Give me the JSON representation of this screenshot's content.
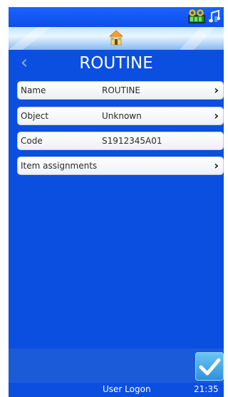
{
  "header": {
    "title": "ROUTINE",
    "home_icon": "home-icon",
    "back_icon": "chevron-left-icon"
  },
  "status": {
    "icons": [
      "device-status-icon",
      "sound-notes-icon"
    ]
  },
  "rows": [
    {
      "label": "Name",
      "value": "ROUTINE",
      "has_chevron": true
    },
    {
      "label": "Object",
      "value": "Unknown",
      "has_chevron": true
    },
    {
      "label": "Code",
      "value": "S1912345A01",
      "has_chevron": false
    },
    {
      "label": "Item assignments",
      "value": "",
      "has_chevron": true
    }
  ],
  "footer": {
    "user": "User Logon",
    "time": "21:35"
  },
  "confirm_icon": "checkmark-icon",
  "colors": {
    "background": "#0b4fe0",
    "row": "#ffffff",
    "confirm": "#3aa0e6"
  }
}
